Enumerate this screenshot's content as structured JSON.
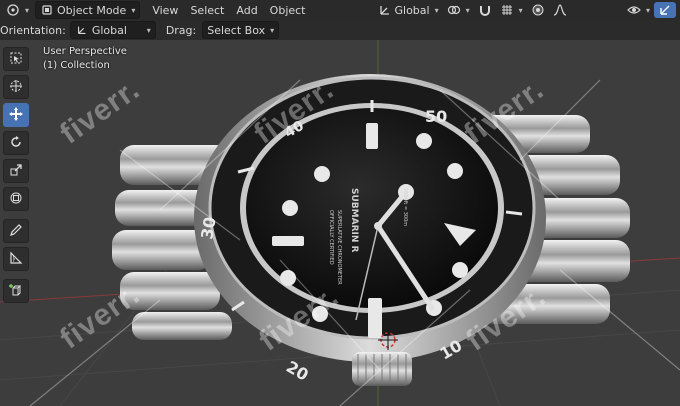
{
  "header": {
    "mode": "Object Mode",
    "menus": [
      "View",
      "Select",
      "Add",
      "Object"
    ],
    "transform_orientation": "Global"
  },
  "subheader": {
    "orientation_label": "Orientation:",
    "orientation_value": "Global",
    "drag_label": "Drag:",
    "drag_value": "Select Box"
  },
  "viewport": {
    "perspective": "User Perspective",
    "collection": "(1) Collection"
  },
  "toolbar": {
    "tools": [
      "select-box",
      "cursor",
      "move",
      "rotate",
      "scale",
      "transform",
      "annotate",
      "measure",
      "add-cube"
    ],
    "active": "move"
  },
  "watch": {
    "brand_text": "SUBMARIN R",
    "dial_lines": [
      "SUPERLATIVE CHRONOMETER",
      "OFFICIALLY CERTIFIED",
      "1000ft = 300m"
    ],
    "bezel_numbers": [
      "10",
      "20",
      "30",
      "40",
      "50"
    ]
  },
  "watermark": "fiverr.",
  "colors": {
    "accent": "#4772b3",
    "header_bg": "#2a2a2a",
    "viewport_bg": "#3d3d3d"
  }
}
